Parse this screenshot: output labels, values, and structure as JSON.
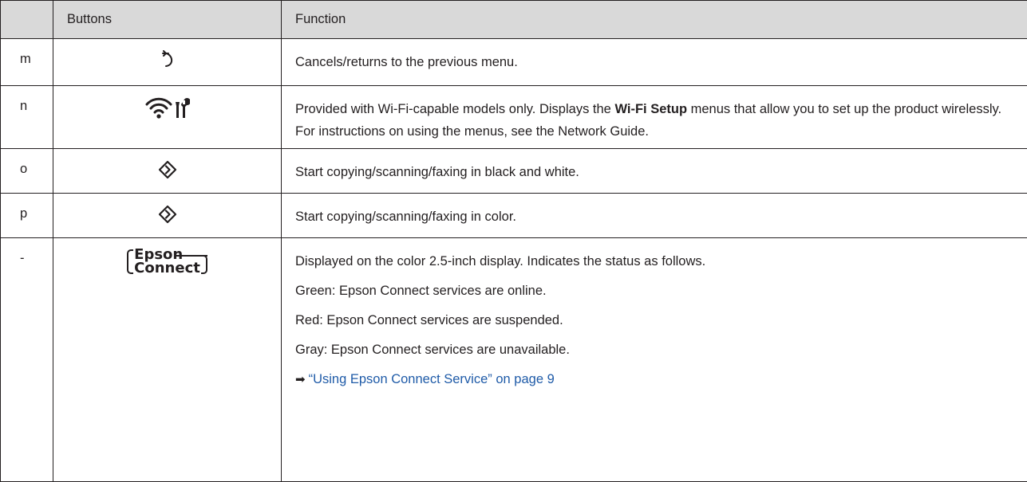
{
  "headers": {
    "key": "",
    "buttons": "Buttons",
    "function": "Function"
  },
  "rows": [
    {
      "key": "m",
      "icon": "back-arrow-icon",
      "function": "Cancels/returns to the previous menu."
    },
    {
      "key": "n",
      "icon": "wifi-setup-icon",
      "function_prefix": "Provided with Wi-Fi-capable models only. Displays the ",
      "function_bold": "Wi-Fi Setup",
      "function_suffix": " menus that allow you to set up the product wirelessly. For instructions on using the menus, see the Network Guide."
    },
    {
      "key": "o",
      "icon": "start-diamond-icon",
      "function": "Start copying/scanning/faxing in black and white."
    },
    {
      "key": "p",
      "icon": "start-diamond-icon",
      "function": "Start copying/scanning/faxing in color."
    },
    {
      "key": "-",
      "icon": "epson-connect-logo",
      "logo_line1": "Epson",
      "logo_line2": "Connect",
      "lines": [
        "Displayed on the color 2.5-inch display. Indicates the status as follows.",
        "Green: Epson Connect services are online.",
        "Red: Epson Connect services are suspended.",
        "Gray: Epson Connect services are unavailable."
      ],
      "link_arrow": "➡",
      "link_text": "“Using Epson Connect Service” on page 9"
    }
  ],
  "colors": {
    "header_bg": "#d9d9d9",
    "border": "#231f20",
    "link": "#1f5ba8"
  }
}
